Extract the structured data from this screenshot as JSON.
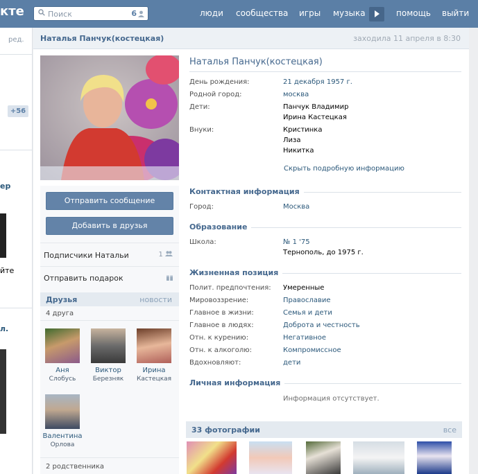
{
  "header": {
    "logo": "кте",
    "search_placeholder": "Поиск",
    "search_count": "6",
    "nav": [
      "люди",
      "сообщества",
      "игры",
      "музыка",
      "помощь",
      "выйти"
    ]
  },
  "leftcol": {
    "edit": "ред.",
    "badge": "+56",
    "frag1": "ер",
    "frag2": "йте",
    "frag3": "л."
  },
  "profile": {
    "header_name": "Наталья Панчук(костецкая)",
    "last_seen": "заходила 11 апреля в 8:30",
    "full_name": "Наталья Панчук(костецкая)"
  },
  "actions": {
    "send_message": "Отправить сообщение",
    "add_friend": "Добавить в друзья",
    "followers": "Подписчики Натальи",
    "followers_count": "1",
    "send_gift": "Отправить подарок"
  },
  "friends": {
    "title": "Друзья",
    "news": "новости",
    "count": "4 друга",
    "list": [
      {
        "first": "Аня",
        "last": "Слобусь"
      },
      {
        "first": "Виктор",
        "last": "Березняк"
      },
      {
        "first": "Ирина",
        "last": "Кастецкая"
      },
      {
        "first": "Валентина",
        "last": "Орлова"
      }
    ],
    "relatives": "2 родственника"
  },
  "basic": {
    "birthday_label": "День рождения:",
    "birthday": "21 декабря 1957 г.",
    "hometown_label": "Родной город:",
    "hometown": "москва",
    "children_label": "Дети:",
    "children": [
      "Панчук Владимир",
      "Ирина Кастецкая"
    ],
    "grandchildren_label": "Внуки:",
    "grandchildren": [
      "Кристинка",
      "Лиза",
      "Никитка"
    ],
    "hide_info": "Скрыть подробную информацию"
  },
  "contact": {
    "title": "Контактная информация",
    "city_label": "Город:",
    "city": "Москва"
  },
  "education": {
    "title": "Образование",
    "school_label": "Школа:",
    "school": "№ 1 '75",
    "school_detail": "Тернополь, до 1975 г."
  },
  "life": {
    "title": "Жизненная позиция",
    "rows": [
      {
        "k": "Полит. предпочтения:",
        "v": "Умеренные",
        "link": false
      },
      {
        "k": "Мировоззрение:",
        "v": "Православие",
        "link": true
      },
      {
        "k": "Главное в жизни:",
        "v": "Семья и дети",
        "link": true
      },
      {
        "k": "Главное в людях:",
        "v": "Доброта и честность",
        "link": true
      },
      {
        "k": "Отн. к курению:",
        "v": "Негативное",
        "link": true
      },
      {
        "k": "Отн. к алкоголю:",
        "v": "Компромиссное",
        "link": true
      },
      {
        "k": "Вдохновляют:",
        "v": "дети",
        "link": true
      }
    ]
  },
  "personal": {
    "title": "Личная информация",
    "empty": "Информация отсутствует."
  },
  "photos": {
    "title": "33 фотографии",
    "all": "все"
  },
  "colors": {
    "header_bg": "#5b7fa6",
    "link": "#2b587a",
    "section": "#45688e",
    "button": "#6383a8"
  }
}
